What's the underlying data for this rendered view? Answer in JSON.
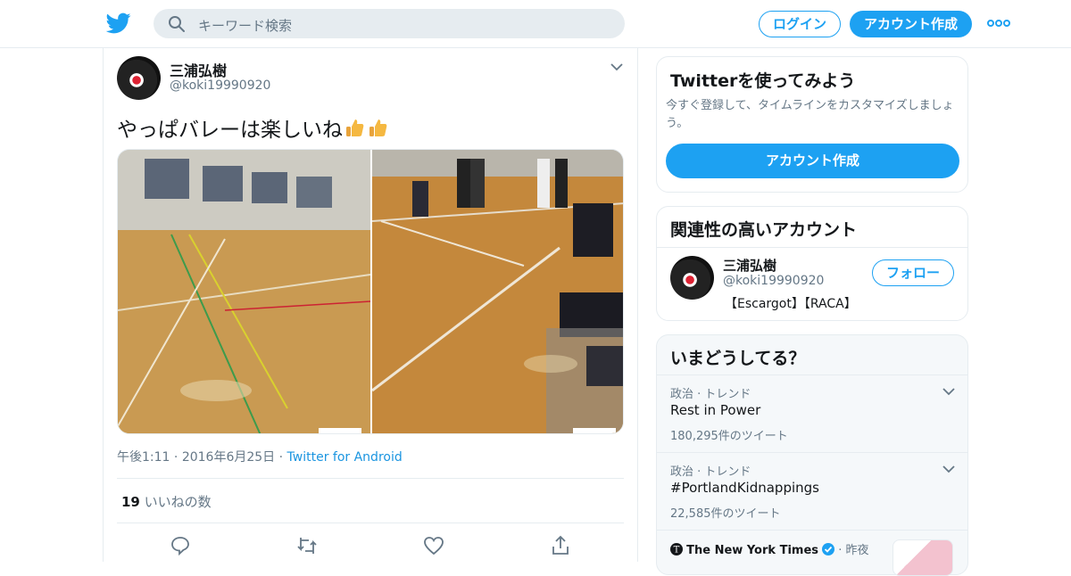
{
  "header": {
    "search_placeholder": "キーワード検索",
    "login_label": "ログイン",
    "signup_label": "アカウント作成"
  },
  "tweet": {
    "name": "三浦弘樹",
    "handle": "@koki19990920",
    "text": "やっぱバレーは楽しいね",
    "time": "午後1:11",
    "date": "2016年6月25日",
    "source": "Twitter for Android",
    "likes_count": "19",
    "likes_label": "いいねの数"
  },
  "signup_card": {
    "title": "Twitterを使ってみよう",
    "desc": "今すぐ登録して、タイムラインをカスタマイズしましょう。",
    "button": "アカウント作成"
  },
  "related_card": {
    "title": "関連性の高いアカウント",
    "name": "三浦弘樹",
    "handle": "@koki19990920",
    "bio": "【Escargot】【RACA】",
    "follow": "フォロー"
  },
  "trends_card": {
    "title": "いまどうしてる？",
    "trends": [
      {
        "category": "政治 · トレンド",
        "name": "Rest in Power",
        "count": "180,295件のツイート"
      },
      {
        "category": "政治 · トレンド",
        "name": "#PortlandKidnappings",
        "count": "22,585件のツイート"
      }
    ],
    "news_source": "The New York Times",
    "news_time": "昨夜"
  },
  "colors": {
    "accent": "#1da1f2",
    "muted": "#657786",
    "border": "#e6ecf0"
  }
}
